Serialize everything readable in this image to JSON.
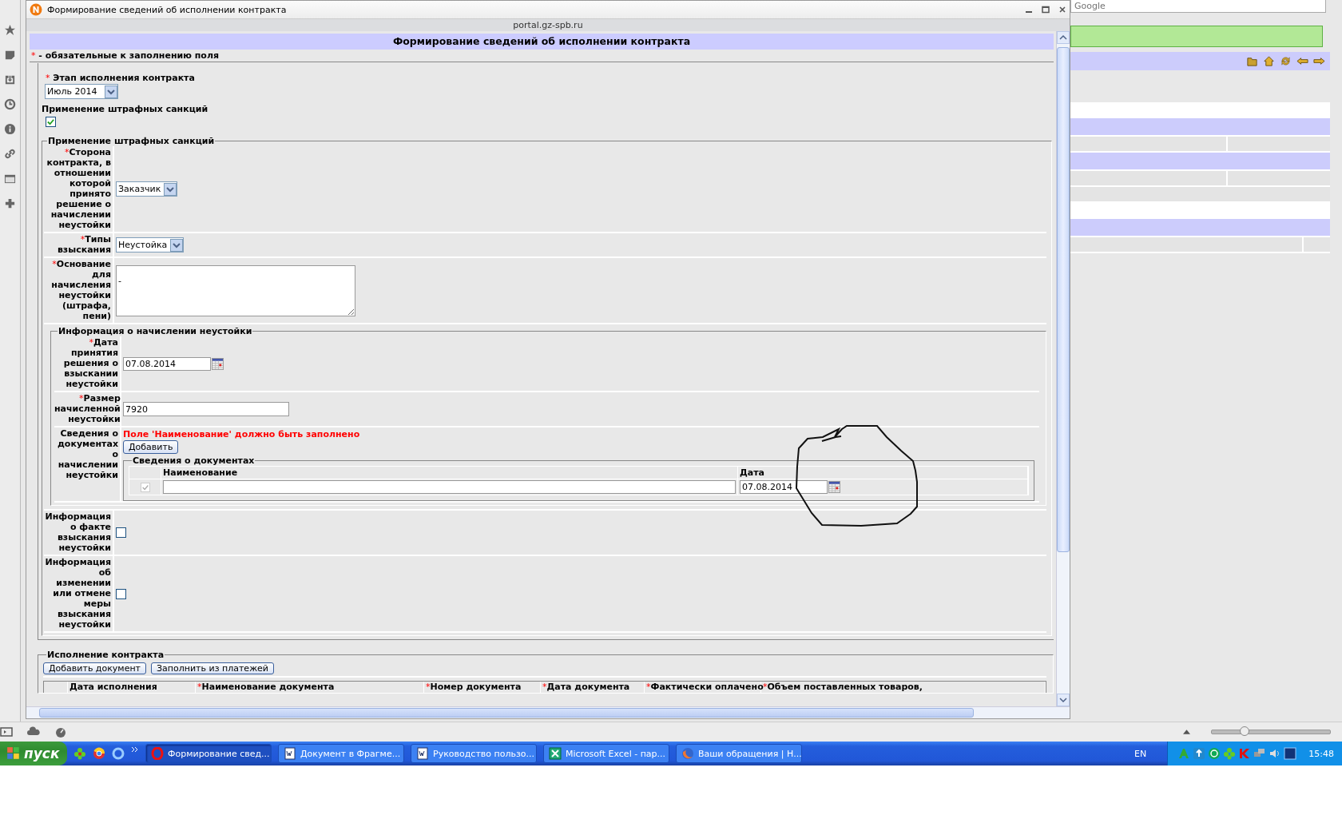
{
  "window": {
    "title": "Формирование сведений об исполнении контракта",
    "url": "portal.gz-spb.ru"
  },
  "page_header": "Формирование сведений об исполнении контракта",
  "required_note": {
    "mark": "*",
    "text": "- обязательные к заполнению поля"
  },
  "stage": {
    "mark": "*",
    "label": "Этап исполнения контракта",
    "value": "Июль 2014"
  },
  "penalty_toggle": {
    "label": "Применение штрафных санкций",
    "checked": true
  },
  "penalty_section": {
    "legend": "Применение штрафных санкций",
    "rows": [
      {
        "kind": "select",
        "mark": "*",
        "label": "Сторона контракта, в отношении которой принято решение о начислении неустойки",
        "value": "Заказчик"
      },
      {
        "kind": "select",
        "mark": "*",
        "label": "Типы взыскания",
        "value": "Неустойка"
      },
      {
        "kind": "textarea",
        "mark": "*",
        "label": "Основание для начисления неустойки (штрафа, пени)",
        "value": "-"
      },
      {
        "kind": "group",
        "legend": "Информация о начислении неустойки",
        "rows": [
          {
            "kind": "date",
            "mark": "*",
            "label": "Дата принятия решения о взыскании неустойки",
            "value": "07.08.2014"
          },
          {
            "kind": "text",
            "mark": "*",
            "label": "Размер начисленной неустойки",
            "value": "7920"
          },
          {
            "kind": "documents",
            "label": "Сведения о документах о начислении неустойки",
            "error": "Поле 'Наименование' должно быть заполнено",
            "button": "Добавить",
            "legend": "Сведения о документах",
            "columns": [
              "Наименование",
              "Дата"
            ],
            "rows": [
              {
                "checked": true,
                "disabled": true,
                "date": "07.08.2014"
              }
            ]
          }
        ]
      },
      {
        "kind": "checkbox",
        "label": "Информация о факте взыскания неустойки",
        "checked": false
      },
      {
        "kind": "checkbox",
        "label": "Информация об изменении или отмене меры взыскания неустойки",
        "checked": false
      }
    ]
  },
  "execution_section": {
    "legend": "Исполнение контракта",
    "buttons": [
      "Добавить документ",
      "Заполнить из платежей"
    ],
    "columns": [
      {
        "label": "Дата исполнения"
      },
      {
        "mark": "*",
        "label": "Наименование документа"
      },
      {
        "mark": "*",
        "label": "Номер документа"
      },
      {
        "mark": "*",
        "label": "Дата документа"
      },
      {
        "mark": "*",
        "label": "Фактически оплачено"
      },
      {
        "mark": "*",
        "label": "Объем поставленных товаров,"
      }
    ]
  },
  "browser": {
    "search": {
      "placeholder": "Google"
    },
    "zoom_slider": {
      "level": 0.28
    }
  },
  "taskbar": {
    "start": "пуск",
    "tasks": [
      {
        "kind": "opera",
        "label": "Формирование свед...",
        "selected": true
      },
      {
        "kind": "word",
        "label": "Документ в Фрагме...",
        "selected": false
      },
      {
        "kind": "word",
        "label": "Руководство пользо...",
        "selected": false
      },
      {
        "kind": "excel",
        "label": "Microsoft Excel - пар...",
        "selected": false
      },
      {
        "kind": "firefox",
        "label": "Ваши обращения | Н...",
        "selected": false
      }
    ],
    "language": "EN",
    "clock": "15:48"
  }
}
